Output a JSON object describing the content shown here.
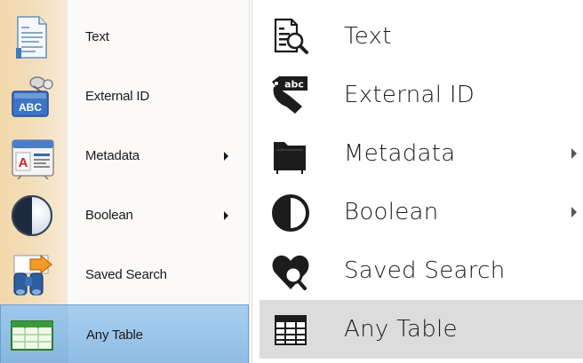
{
  "old_menu": {
    "items": [
      {
        "label": "Text",
        "icon": "text-document-icon",
        "has_submenu": false,
        "selected": false
      },
      {
        "label": "External ID",
        "icon": "abc-tag-icon",
        "has_submenu": false,
        "selected": false
      },
      {
        "label": "Metadata",
        "icon": "metadata-card-icon",
        "has_submenu": true,
        "selected": false
      },
      {
        "label": "Boolean",
        "icon": "half-circle-icon",
        "has_submenu": true,
        "selected": false
      },
      {
        "label": "Saved Search",
        "icon": "binoculars-arrow-icon",
        "has_submenu": false,
        "selected": false
      },
      {
        "label": "Any Table",
        "icon": "green-table-icon",
        "has_submenu": false,
        "selected": true
      }
    ]
  },
  "new_menu": {
    "items": [
      {
        "label": "Text",
        "icon": "document-magnifier-icon",
        "has_submenu": false,
        "selected": false
      },
      {
        "label": "External ID",
        "icon": "abc-tag-icon",
        "has_submenu": false,
        "selected": false
      },
      {
        "label": "Metadata",
        "icon": "folder-icon",
        "has_submenu": true,
        "selected": false
      },
      {
        "label": "Boolean",
        "icon": "half-circle-icon",
        "has_submenu": true,
        "selected": false
      },
      {
        "label": "Saved Search",
        "icon": "heart-magnifier-icon",
        "has_submenu": false,
        "selected": false
      },
      {
        "label": "Any Table",
        "icon": "table-grid-icon",
        "has_submenu": false,
        "selected": true
      }
    ],
    "tag_text": "abc"
  },
  "colors": {
    "old_gutter": "#f1d7aa",
    "old_selected": "#a8cfee",
    "new_selected": "#dcdcdc",
    "icon_dark": "#1c1c1c"
  }
}
